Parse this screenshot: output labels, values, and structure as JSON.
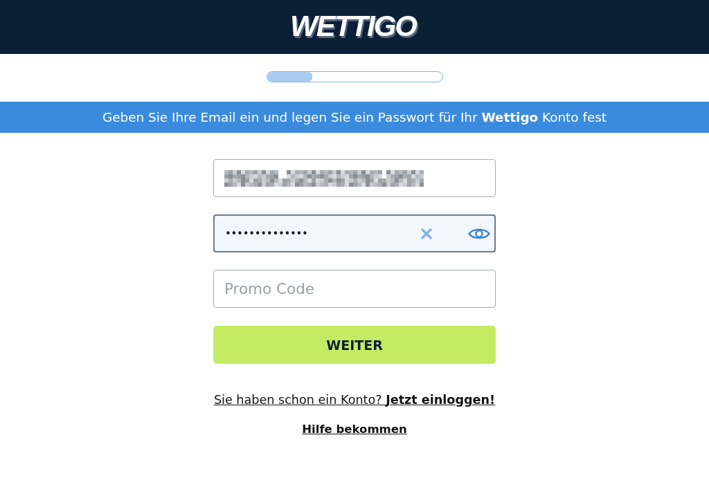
{
  "header": {
    "logo": "WETTIGO"
  },
  "progress": {
    "level": 0.26
  },
  "banner": {
    "text": "Geben Sie Ihre Email ein und legen Sie ein Passwort für Ihr **Wettigo** Konto fest"
  },
  "fields": [
    {
      "kind": "email",
      "redacted": true,
      "focused": false
    },
    {
      "kind": "password",
      "value": "••••••••••••••",
      "focused": true,
      "clearable": true,
      "reveal_toggle": true
    },
    {
      "kind": "promo",
      "placeholder": "Promo Code",
      "focused": false
    }
  ],
  "submit_button": {
    "label": "WEITER"
  },
  "links": [
    {
      "kind": "login",
      "text": "Sie haben schon ein Konto? **Jetzt einloggen!**"
    },
    {
      "kind": "help",
      "text": "Hilfe bekommen"
    }
  ]
}
